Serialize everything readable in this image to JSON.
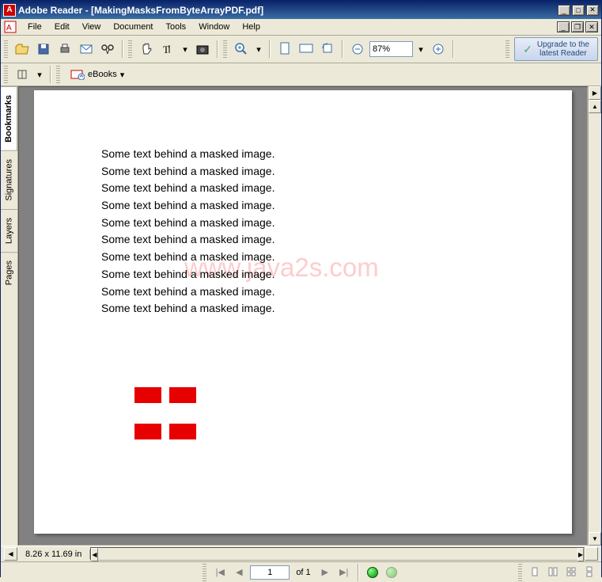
{
  "titlebar": {
    "app": "Adobe Reader",
    "doc": "[MakingMasksFromByteArrayPDF.pdf]"
  },
  "menu": {
    "file": "File",
    "edit": "Edit",
    "view": "View",
    "document": "Document",
    "tools": "Tools",
    "window": "Window",
    "help": "Help"
  },
  "toolbar": {
    "zoom_value": "87%",
    "upgrade_line1": "Upgrade to the",
    "upgrade_line2": "latest Reader",
    "ebooks": "eBooks"
  },
  "sidetabs": {
    "bookmarks": "Bookmarks",
    "signatures": "Signatures",
    "layers": "Layers",
    "pages": "Pages"
  },
  "document": {
    "text_line": "Some text behind a masked image.",
    "watermark": "www.java2s.com"
  },
  "status": {
    "page_size": "8.26 x 11.69 in"
  },
  "nav": {
    "page_num": "1",
    "of": "of 1"
  }
}
